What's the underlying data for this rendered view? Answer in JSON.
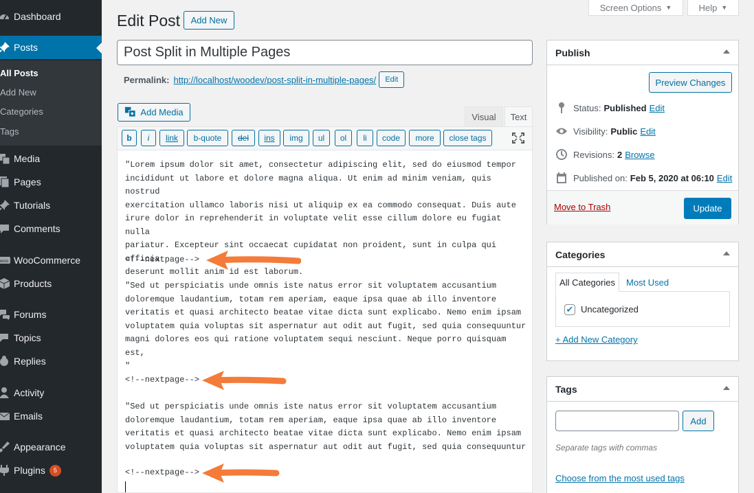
{
  "sidebar": {
    "items": [
      {
        "label": "Dashboard",
        "icon": "dashboard-icon"
      },
      {
        "label": "Posts",
        "icon": "pushpin-icon"
      },
      {
        "label": "Media",
        "icon": "media-icon"
      },
      {
        "label": "Pages",
        "icon": "pages-icon"
      },
      {
        "label": "Tutorials",
        "icon": "pushpin-icon"
      },
      {
        "label": "Comments",
        "icon": "comment-icon"
      },
      {
        "label": "WooCommerce",
        "icon": "woo-icon"
      },
      {
        "label": "Products",
        "icon": "box-icon"
      },
      {
        "label": "Forums",
        "icon": "forums-icon"
      },
      {
        "label": "Topics",
        "icon": "topics-icon"
      },
      {
        "label": "Replies",
        "icon": "replies-icon"
      },
      {
        "label": "Activity",
        "icon": "activity-icon"
      },
      {
        "label": "Emails",
        "icon": "email-icon"
      },
      {
        "label": "Appearance",
        "icon": "brush-icon"
      },
      {
        "label": "Plugins",
        "icon": "plugin-icon",
        "badge": "5"
      }
    ],
    "posts_submenu": [
      "All Posts",
      "Add New",
      "Categories",
      "Tags"
    ]
  },
  "top": {
    "screen_options": "Screen Options",
    "help": "Help",
    "page_title": "Edit Post",
    "add_new": "Add New"
  },
  "post": {
    "title": "Post Split in Multiple Pages",
    "permalink_label": "Permalink:",
    "permalink_base": "http://localhost/woodev/",
    "permalink_slug": "post-split-in-multiple-pages/",
    "edit_slug": "Edit"
  },
  "editor": {
    "add_media": "Add Media",
    "tab_visual": "Visual",
    "tab_text": "Text",
    "quicktags": [
      "b",
      "i",
      "link",
      "b-quote",
      "del",
      "ins",
      "img",
      "ul",
      "ol",
      "li",
      "code",
      "more",
      "close tags"
    ],
    "paragraph_1": "\"Lorem ipsum dolor sit amet, consectetur adipiscing elit, sed do eiusmod tempor\nincididunt ut labore et dolore magna aliqua. Ut enim ad minim veniam, quis nostrud\nexercitation ullamco laboris nisi ut aliquip ex ea commodo consequat. Duis aute\nirure dolor in reprehenderit in voluptate velit esse cillum dolore eu fugiat nulla\npariatur. Excepteur sint occaecat cupidatat non proident, sunt in culpa qui officia\ndeserunt mollit anim id est laborum.",
    "nextpage": "<!--nextpage-->",
    "paragraph_2": "\"Sed ut perspiciatis unde omnis iste natus error sit voluptatem accusantium\ndoloremque laudantium, totam rem aperiam, eaque ipsa quae ab illo inventore\nveritatis et quasi architecto beatae vitae dicta sunt explicabo. Nemo enim ipsam\nvoluptatem quia voluptas sit aspernatur aut odit aut fugit, sed quia consequuntur\nmagni dolores eos qui ratione voluptatem sequi nesciunt. Neque porro quisquam est,\n\"",
    "paragraph_3": "\"Sed ut perspiciatis unde omnis iste natus error sit voluptatem accusantium\ndoloremque laudantium, totam rem aperiam, eaque ipsa quae ab illo inventore\nveritatis et quasi architecto beatae vitae dicta sunt explicabo. Nemo enim ipsam\nvoluptatem quia voluptas sit aspernatur aut odit aut fugit, sed quia consequuntur",
    "arrow_color": "#f47b3a"
  },
  "publish": {
    "title": "Publish",
    "preview": "Preview Changes",
    "status_label": "Status:",
    "status_value": "Published",
    "visibility_label": "Visibility:",
    "visibility_value": "Public",
    "revisions_label": "Revisions:",
    "revisions_value": "2",
    "revisions_link": "Browse",
    "published_label": "Published on:",
    "published_value": "Feb 5, 2020 at 06:10",
    "edit": "Edit",
    "trash": "Move to Trash",
    "update": "Update"
  },
  "categories": {
    "title": "Categories",
    "tab_all": "All Categories",
    "tab_used": "Most Used",
    "item": "Uncategorized",
    "add_new": "+ Add New Category"
  },
  "tags": {
    "title": "Tags",
    "add": "Add",
    "hint": "Separate tags with commas",
    "choose": "Choose from the most used tags"
  },
  "colors": {
    "sidebar_bg": "#23282d",
    "accent": "#0073aa",
    "primary_button": "#007cba"
  }
}
